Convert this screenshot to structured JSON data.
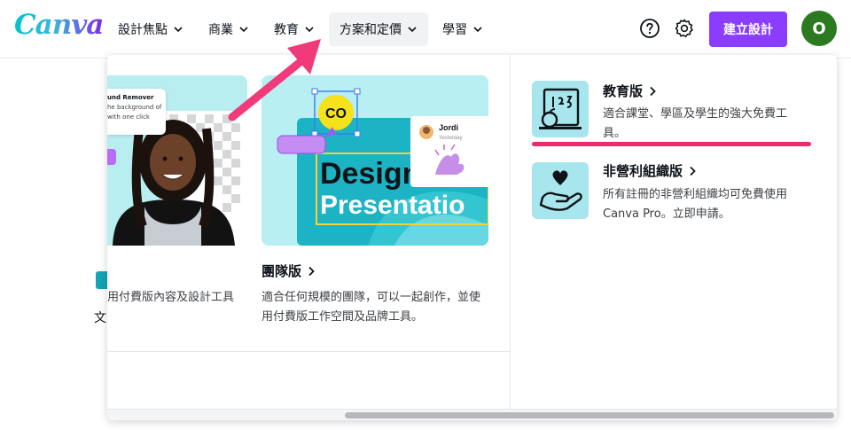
{
  "brand": {
    "logo_text": "Canva",
    "accent": "#8b3dff",
    "brand_teal": "#00c4cc"
  },
  "nav": {
    "items": [
      {
        "label": "設計焦點"
      },
      {
        "label": "商業"
      },
      {
        "label": "教育"
      },
      {
        "label": "方案和定價"
      },
      {
        "label": "學習"
      }
    ],
    "active_index": 3
  },
  "header": {
    "help_icon": "help-circle-icon",
    "settings_icon": "gear-icon",
    "create_label": "建立設計",
    "avatar_letter": "O"
  },
  "background_page": {
    "partial_char": "文"
  },
  "dropdown": {
    "card1": {
      "badge_title": "und Remover",
      "badge_line1": "he background of",
      "badge_line2": "with one click",
      "desc_partial": "用付費版內容及設計工具"
    },
    "card2": {
      "title": "團隊版",
      "description": "適合任何規模的團隊，可以一起創作，並使用付費版工作空間及品牌工具。",
      "comment_name": "Jordi",
      "comment_time": "Yesterday",
      "logo_mark": "CO",
      "design_line1": "Design",
      "design_line2": "Presentatio"
    },
    "education": {
      "title": "教育版",
      "description": "適合課堂、學區及學生的強大免費工具。"
    },
    "nonprofit": {
      "title": "非營利組織版",
      "description": "所有註冊的非營利組織均可免費使用 Canva Pro。立即申請。"
    }
  },
  "annotation_color": "#f03a7a",
  "underline_color": "#ea2b6e"
}
